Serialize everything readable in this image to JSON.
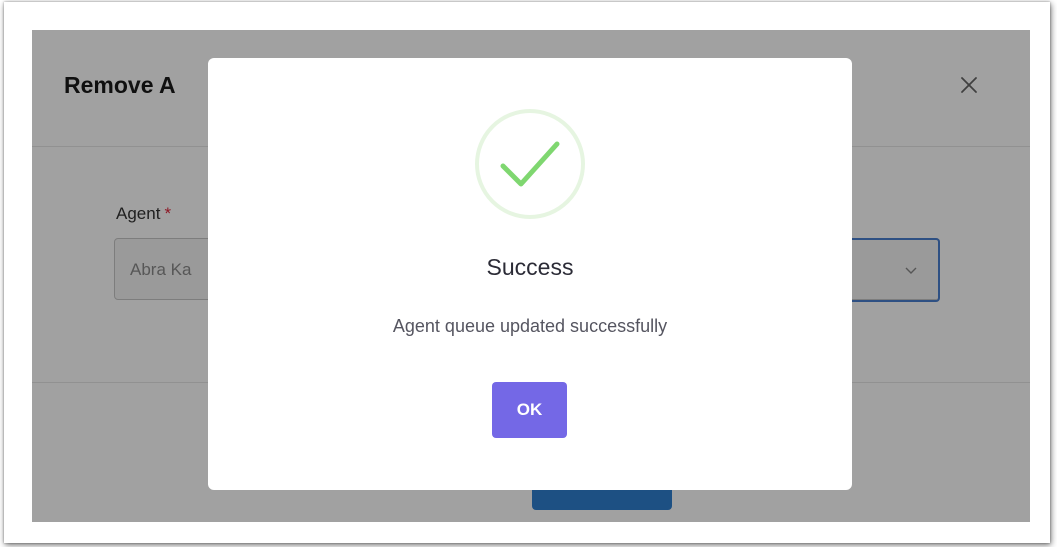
{
  "background_dialog": {
    "title": "Remove A",
    "field": {
      "label": "Agent",
      "required_mark": "*",
      "value": "Abra Ka"
    },
    "icons": {
      "close": "close-icon",
      "dropdown": "chevron-down-icon"
    }
  },
  "success_dialog": {
    "icon": "checkmark-circle-icon",
    "title": "Success",
    "message": "Agent queue updated successfully",
    "ok_label": "OK"
  },
  "colors": {
    "accent": "#7468e6",
    "success": "#7fd770",
    "required": "#e0263c",
    "focus_border": "#4a7fd0"
  }
}
